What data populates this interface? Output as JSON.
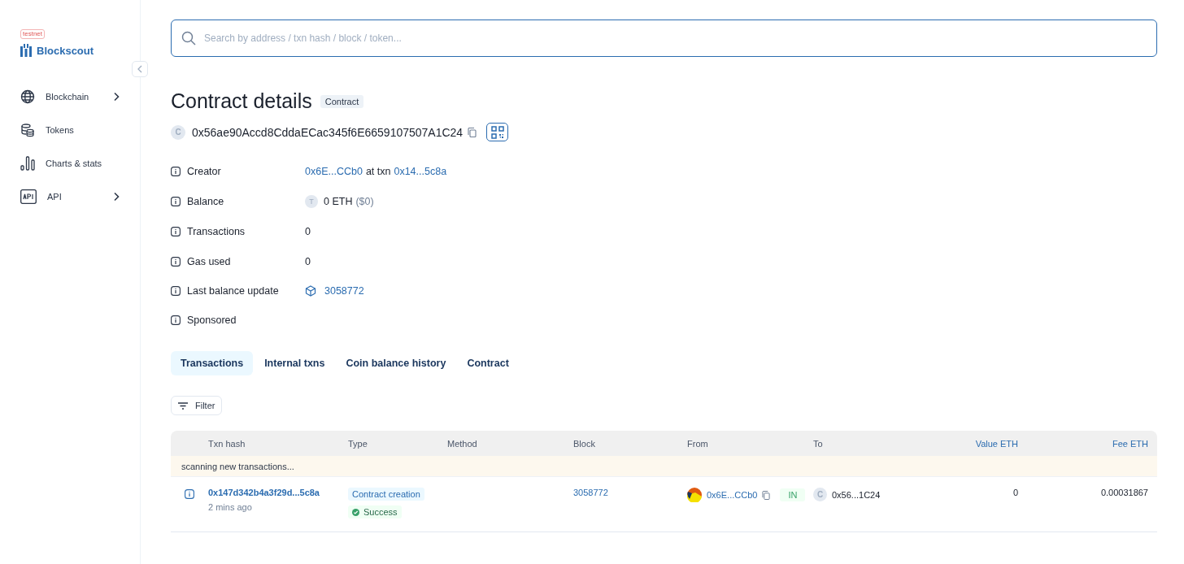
{
  "sidebar": {
    "badge": "testnet",
    "logo": "Blockscout",
    "items": [
      {
        "label": "Blockchain",
        "expandable": true
      },
      {
        "label": "Tokens",
        "expandable": false
      },
      {
        "label": "Charts & stats",
        "expandable": false
      },
      {
        "label": "API",
        "expandable": true
      }
    ]
  },
  "search": {
    "placeholder": "Search by address / txn hash / block / token..."
  },
  "page": {
    "title": "Contract details",
    "tag": "Contract",
    "address_avatar": "C",
    "address": "0x56ae90Accd8CddaECac345f6E6659107507A1C24"
  },
  "details": [
    {
      "kind": "creator",
      "label": "Creator",
      "creator": "0x6E...CCb0",
      "joiner": "at txn",
      "txn": "0x14...5c8a"
    },
    {
      "kind": "balance",
      "label": "Balance",
      "token": "T",
      "amount": "0 ETH",
      "usd": "($0)"
    },
    {
      "kind": "text",
      "label": "Transactions",
      "value": "0"
    },
    {
      "kind": "text",
      "label": "Gas used",
      "value": "0"
    },
    {
      "kind": "block",
      "label": "Last balance update",
      "value": "3058772"
    },
    {
      "kind": "empty",
      "label": "Sponsored"
    }
  ],
  "tabs": [
    {
      "label": "Transactions",
      "selected": true
    },
    {
      "label": "Internal txns",
      "selected": false
    },
    {
      "label": "Coin balance history",
      "selected": false
    },
    {
      "label": "Contract",
      "selected": false
    }
  ],
  "filter": "Filter",
  "table": {
    "columns": [
      {
        "label": "Txn hash",
        "sortable": false
      },
      {
        "label": "Type",
        "sortable": false
      },
      {
        "label": "Method",
        "sortable": false
      },
      {
        "label": "Block",
        "sortable": false
      },
      {
        "label": "From",
        "sortable": false
      },
      {
        "label": "To",
        "sortable": false
      },
      {
        "label": "Value ETH",
        "sortable": true
      },
      {
        "label": "Fee ETH",
        "sortable": true
      }
    ],
    "notice": "scanning new transactions...",
    "rows": [
      {
        "hash": "0x147d342b4a3f29d...5c8a",
        "age": "2 mins ago",
        "type": "Contract creation",
        "status": "Success",
        "block": "3058772",
        "from": "0x6E...CCb0",
        "direction": "IN",
        "to_avatar": "C",
        "to": "0x56...1C24",
        "value": "0",
        "fee": "0.00031867"
      }
    ]
  }
}
